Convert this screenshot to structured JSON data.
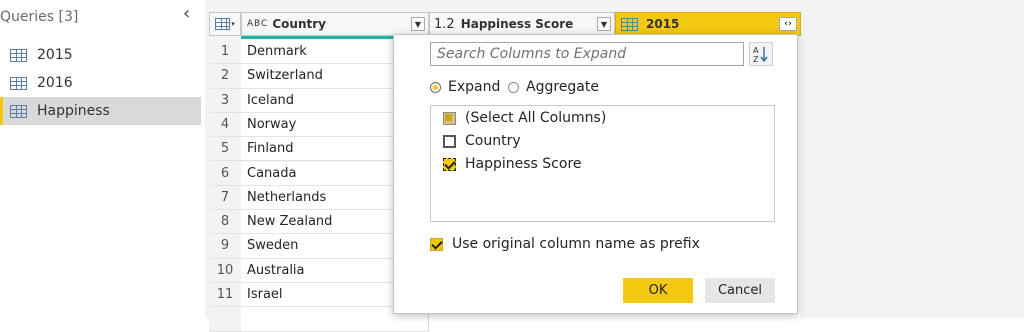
{
  "queries": {
    "title": "Queries [3]",
    "collapse_icon": "chevron-left-icon",
    "items": [
      {
        "label": "2015",
        "icon": "table-icon",
        "selected": false
      },
      {
        "label": "2016",
        "icon": "table-icon",
        "selected": false
      },
      {
        "label": "Happiness",
        "icon": "table-icon",
        "selected": true
      }
    ]
  },
  "grid": {
    "columns": [
      {
        "type_label": "A B C",
        "name": "Country"
      },
      {
        "type_label": "1.2",
        "name": "Happiness Score"
      },
      {
        "type_label": "",
        "name": "2015"
      }
    ],
    "rows": [
      {
        "num": "1",
        "country": "Denmark"
      },
      {
        "num": "2",
        "country": "Switzerland"
      },
      {
        "num": "3",
        "country": "Iceland"
      },
      {
        "num": "4",
        "country": "Norway"
      },
      {
        "num": "5",
        "country": "Finland"
      },
      {
        "num": "6",
        "country": "Canada"
      },
      {
        "num": "7",
        "country": "Netherlands"
      },
      {
        "num": "8",
        "country": "New Zealand"
      },
      {
        "num": "9",
        "country": "Sweden"
      },
      {
        "num": "10",
        "country": "Australia"
      },
      {
        "num": "11",
        "country": "Israel"
      }
    ]
  },
  "expand_popup": {
    "search_placeholder": "Search Columns to Expand",
    "mode_options": [
      {
        "label": "Expand",
        "selected": true
      },
      {
        "label": "Aggregate",
        "selected": false
      }
    ],
    "columns": [
      {
        "label": "(Select All Columns)",
        "state": "partial"
      },
      {
        "label": "Country",
        "state": "unchecked"
      },
      {
        "label": "Happiness Score",
        "state": "checked"
      }
    ],
    "prefix_label": "Use original column name as prefix",
    "prefix_checked": true,
    "ok_label": "OK",
    "cancel_label": "Cancel"
  },
  "colors": {
    "accent": "#f2c811",
    "selected_bg": "#d9d9d9"
  }
}
